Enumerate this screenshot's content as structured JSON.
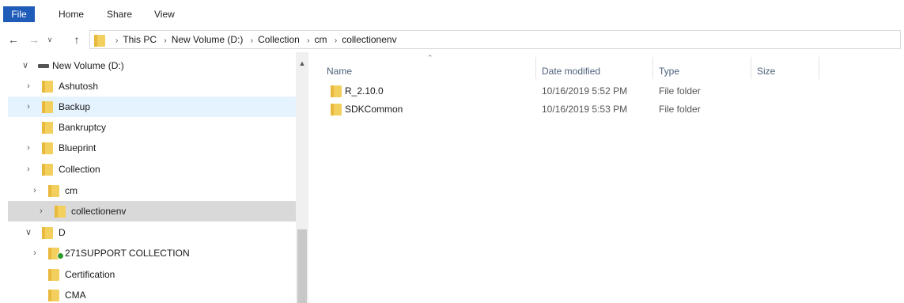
{
  "ribbon": {
    "tabs": [
      "File",
      "Home",
      "Share",
      "View"
    ],
    "active_color": "#1f5bb8"
  },
  "nav": {
    "back_icon": "arrow-left-icon",
    "forward_icon": "arrow-right-icon",
    "recent_icon": "chevron-down-icon",
    "up_icon": "arrow-up-icon"
  },
  "address": {
    "crumbs": [
      "This PC",
      "New Volume (D:)",
      "Collection",
      "cm",
      "collectionenv"
    ]
  },
  "tree": {
    "items": [
      {
        "label": "New Volume (D:)",
        "chevron": "∨",
        "icon": "drive"
      },
      {
        "label": "Ashutosh",
        "chevron": "›",
        "icon": "folder"
      },
      {
        "label": "Backup",
        "chevron": "›",
        "icon": "folder"
      },
      {
        "label": "Bankruptcy",
        "chevron": "",
        "icon": "folder"
      },
      {
        "label": "Blueprint",
        "chevron": "›",
        "icon": "folder"
      },
      {
        "label": "Collection",
        "chevron": "›",
        "icon": "folder"
      },
      {
        "label": "cm",
        "chevron": "›",
        "icon": "folder"
      },
      {
        "label": "collectionenv",
        "chevron": "›",
        "icon": "folder"
      },
      {
        "label": "D",
        "chevron": "∨",
        "icon": "folder"
      },
      {
        "label": "271SUPPORT COLLECTION",
        "chevron": "›",
        "icon": "folder-synced"
      },
      {
        "label": "Certification",
        "chevron": "",
        "icon": "folder"
      },
      {
        "label": "CMA",
        "chevron": "",
        "icon": "folder"
      }
    ]
  },
  "columns": {
    "name": "Name",
    "date": "Date modified",
    "type": "Type",
    "size": "Size"
  },
  "files": [
    {
      "name": "R_2.10.0",
      "date": "10/16/2019 5:52 PM",
      "type": "File folder"
    },
    {
      "name": "SDKCommon",
      "date": "10/16/2019 5:53 PM",
      "type": "File folder"
    }
  ],
  "colors": {
    "hover": "#e5f3ff",
    "selected": "#d9d9d9",
    "folder": "#f3cf5e"
  }
}
